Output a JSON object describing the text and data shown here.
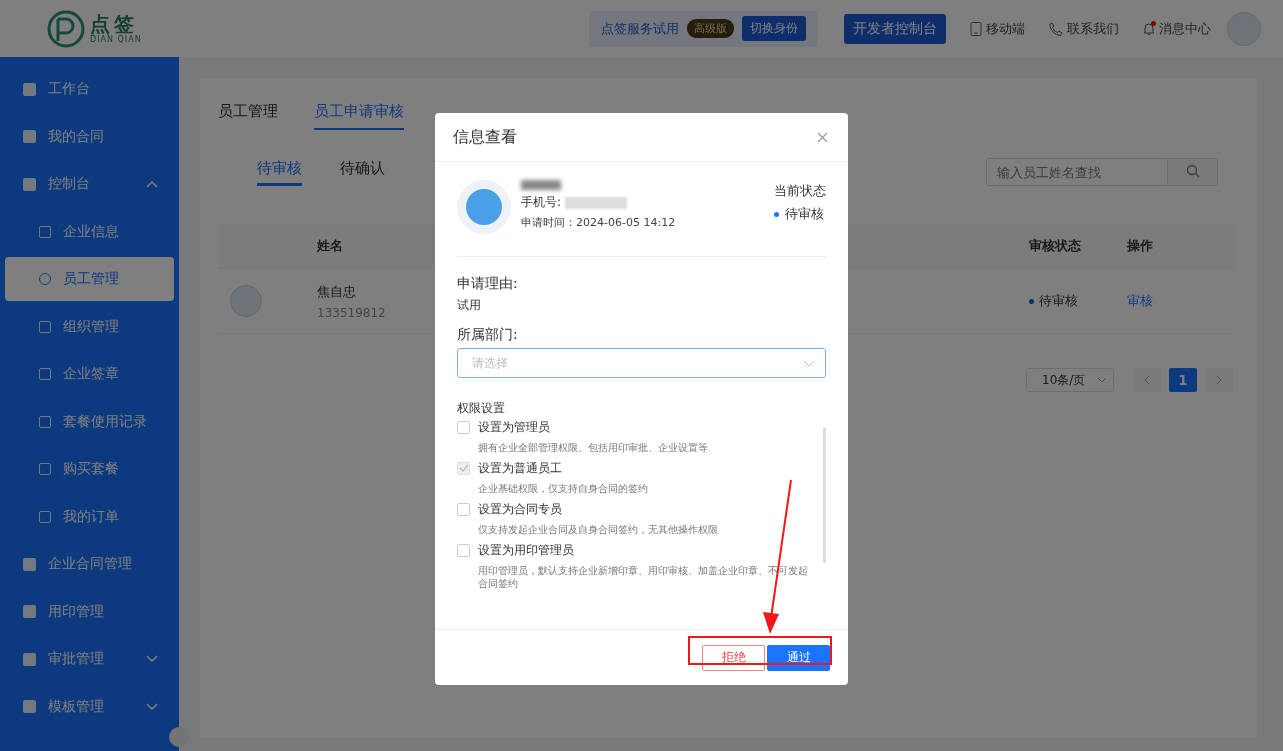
{
  "header": {
    "logo_text": "点签",
    "logo_subtext": "DIAN QIAN",
    "trial": {
      "label": "点签服务试用",
      "badge": "高级版",
      "switch_button": "切换身份"
    },
    "developer_button": "开发者控制台",
    "links": [
      {
        "label": "移动端"
      },
      {
        "label": "联系我们"
      },
      {
        "label": "消息中心",
        "dot": true
      }
    ]
  },
  "sidebar": {
    "items": [
      {
        "label": "工作台",
        "selected": false
      },
      {
        "label": "我的合同",
        "selected": false
      },
      {
        "label": "控制台",
        "selected": false,
        "expanded": true,
        "children": [
          {
            "label": "企业信息",
            "selected": false
          },
          {
            "label": "员工管理",
            "selected": true
          },
          {
            "label": "组织管理",
            "selected": false
          },
          {
            "label": "企业签章",
            "selected": false
          },
          {
            "label": "套餐使用记录",
            "selected": false
          },
          {
            "label": "购买套餐",
            "selected": false
          },
          {
            "label": "我的订单",
            "selected": false
          }
        ]
      },
      {
        "label": "企业合同管理",
        "selected": false
      },
      {
        "label": "用印管理",
        "selected": false
      },
      {
        "label": "审批管理",
        "selected": false,
        "expanded": false
      },
      {
        "label": "模板管理",
        "selected": false,
        "expanded": false
      }
    ]
  },
  "main": {
    "tabs": [
      {
        "label": "员工管理",
        "selected": false
      },
      {
        "label": "员工申请审核",
        "selected": true
      }
    ],
    "subtabs": [
      {
        "label": "待审核",
        "selected": true
      },
      {
        "label": "待确认",
        "selected": false
      }
    ],
    "search": {
      "placeholder": "输入员工姓名查找"
    },
    "table": {
      "columns": [
        "姓名",
        "审核状态",
        "操作"
      ],
      "rows": [
        {
          "name": "焦自忠",
          "phone": "133519812",
          "status": "待审核",
          "action": "审核"
        }
      ]
    },
    "pagination": {
      "page_size": "10条/页",
      "pages": [
        {
          "label": "1",
          "selected": true
        }
      ]
    }
  },
  "dialog": {
    "title": "信息查看",
    "phone_label": "手机号:",
    "applied_time": "申请时间：2024-06-05 14:12",
    "status_label": "当前状态",
    "status": "待审核",
    "reason_label": "申请理由:",
    "reason": "试用",
    "department_label": "所属部门:",
    "department_placeholder": "请选择",
    "permissions_label": "权限设置",
    "permissions": [
      {
        "label": "设置为管理员",
        "description": "拥有企业全部管理权限、包括用印审批、企业设置等",
        "checked": false,
        "disabled": false
      },
      {
        "label": "设置为普通员工",
        "description": "企业基础权限，仅支持自身合同的签约",
        "checked": true,
        "disabled": true
      },
      {
        "label": "设置为合同专员",
        "description": "仅支持发起企业合同及自身合同签约，无其他操作权限",
        "checked": false,
        "disabled": false
      },
      {
        "label": "设置为用印管理员",
        "description": "用印管理员，默认支持企业新增印章、用印审核、加盖企业印章、不可发起合同签约",
        "checked": false,
        "disabled": false
      }
    ],
    "buttons": [
      {
        "label": "拒绝",
        "kind": "reject"
      },
      {
        "label": "通过",
        "kind": "approve"
      }
    ]
  }
}
